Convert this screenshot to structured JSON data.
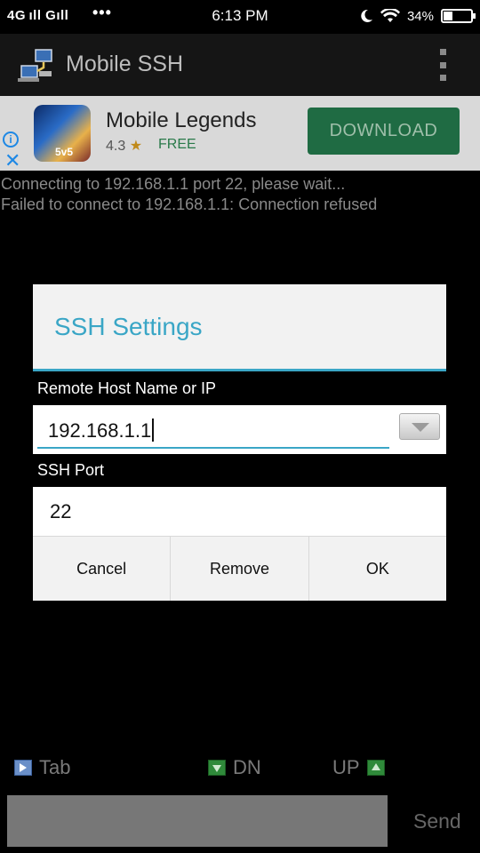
{
  "status_bar": {
    "network": "4G ıll Gıll",
    "more": "•••",
    "time": "6:13 PM",
    "battery": "34%",
    "battery_level": 0.34,
    "icons": [
      "moon-icon",
      "wifi-icon",
      "battery-icon"
    ]
  },
  "app_bar": {
    "title": "Mobile SSH",
    "icon": "network-computers-icon",
    "menu_icon": "overflow-menu-icon"
  },
  "ad": {
    "name": "Mobile Legends",
    "rating": "4.3",
    "price": "FREE",
    "button": "DOWNLOAD",
    "icon_text": "5v5"
  },
  "log": [
    "Connecting to 192.168.1.1 port 22, please wait...",
    "Failed to connect to 192.168.1.1: Connection refused"
  ],
  "dialog": {
    "title": "SSH Settings",
    "host_label": "Remote Host Name or IP",
    "host_value": "192.168.1.1",
    "port_label": "SSH Port",
    "port_value": "22",
    "buttons": {
      "cancel": "Cancel",
      "remove": "Remove",
      "ok": "OK"
    }
  },
  "keys": {
    "tab": "Tab",
    "dn": "DN",
    "up": "UP"
  },
  "input": {
    "value": "",
    "send": "Send"
  },
  "colors": {
    "accent": "#3aa6c6",
    "download": "#1f6b43"
  }
}
